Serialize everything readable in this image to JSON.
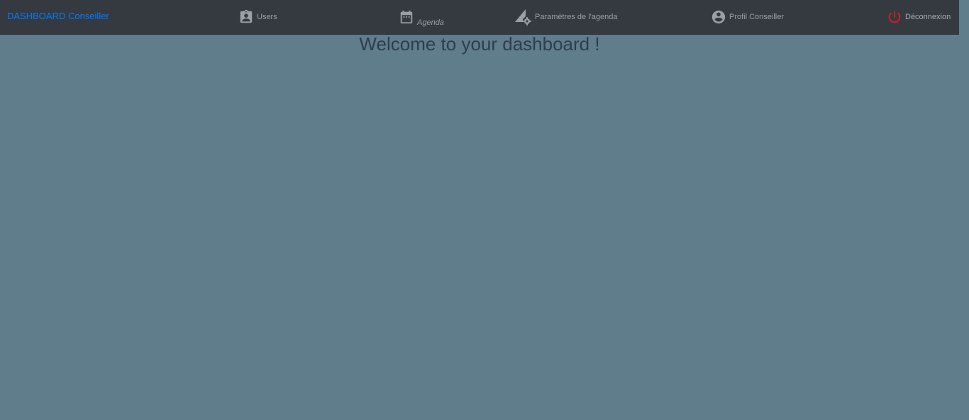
{
  "navbar": {
    "brand": "DASHBOARD Conseiller",
    "items": [
      {
        "label": "Users",
        "icon": "badge-icon"
      },
      {
        "label": "Agenda",
        "icon": "calendar-icon"
      },
      {
        "label": "Paramètres de l'agenda",
        "icon": "settings-wedge-icon"
      },
      {
        "label": "Profil Conseiller",
        "icon": "account-circle-icon"
      },
      {
        "label": "Déconnexion",
        "icon": "power-icon"
      }
    ]
  },
  "main": {
    "welcome": "Welcome to your dashboard !"
  },
  "colors": {
    "navbar_bg": "#343a40",
    "page_bg": "#607d8b",
    "brand": "#007bff",
    "logout_icon": "#e0191f",
    "nav_icon": "#9aa0a6",
    "heading": "#2c3e50"
  }
}
